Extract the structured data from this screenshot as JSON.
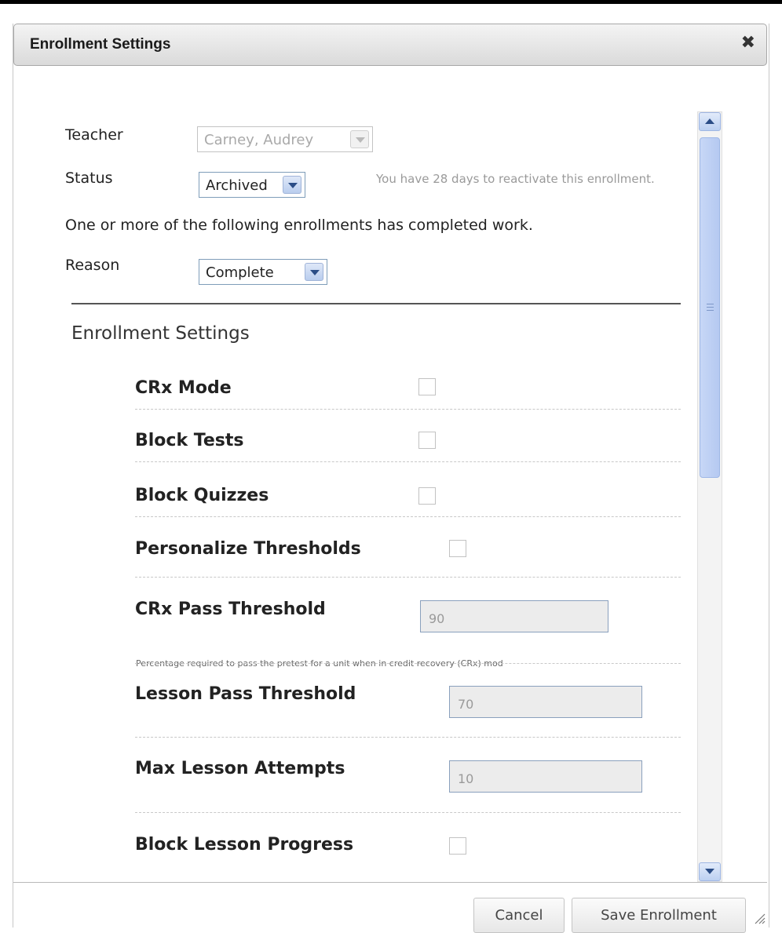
{
  "dialog": {
    "title": "Enrollment Settings",
    "close_icon": "close-icon"
  },
  "form": {
    "teacher_label": "Teacher",
    "teacher_value": "Carney, Audrey",
    "status_label": "Status",
    "status_value": "Archived",
    "status_note": "You have 28 days to reactivate this enrollment.",
    "completed_notice": "One or more of the following enrollments has completed work.",
    "reason_label": "Reason",
    "reason_value": "Complete"
  },
  "settings": {
    "heading": "Enrollment Settings",
    "crx_mode": {
      "label": "CRx Mode",
      "checked": false
    },
    "block_tests": {
      "label": "Block Tests",
      "checked": false
    },
    "block_quizzes": {
      "label": "Block Quizzes",
      "checked": false
    },
    "personalize_thresholds": {
      "label": "Personalize Thresholds",
      "checked": false
    },
    "crx_pass_threshold": {
      "label": "CRx Pass Threshold",
      "value": "90",
      "hint": "Percentage required to pass the pretest for a unit when in credit recovery (CRx) mod"
    },
    "lesson_pass_threshold": {
      "label": "Lesson Pass Threshold",
      "value": "70"
    },
    "max_lesson_attempts": {
      "label": "Max Lesson Attempts",
      "value": "10"
    },
    "block_lesson_progress": {
      "label": "Block Lesson Progress",
      "checked": false
    }
  },
  "footer": {
    "cancel_label": "Cancel",
    "save_label": "Save Enrollment"
  },
  "colors": {
    "scrollbar_accent": "#b9cdee",
    "input_border": "#7f9db9"
  }
}
